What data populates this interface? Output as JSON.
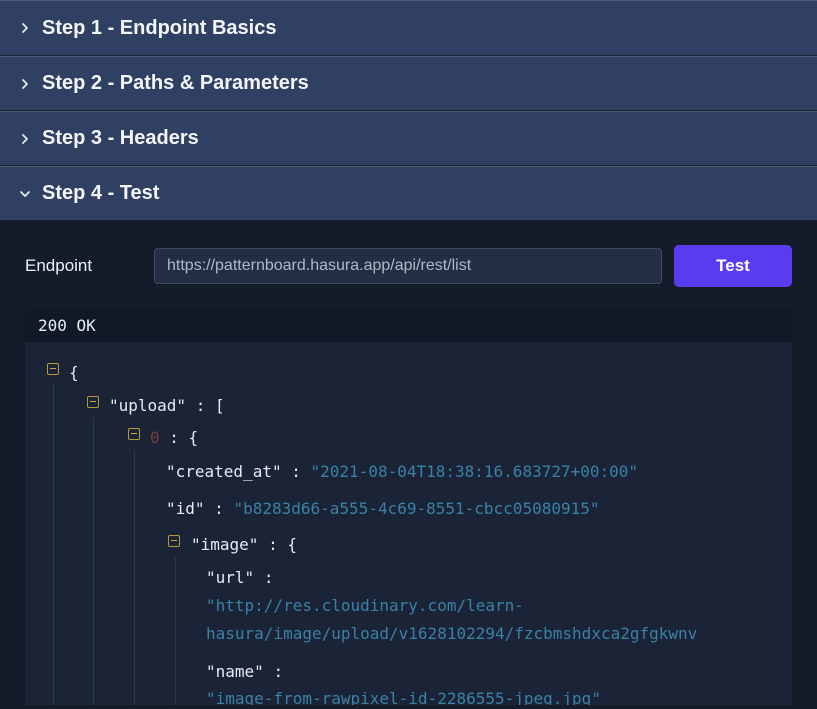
{
  "steps": [
    {
      "label": "Step 1 - Endpoint Basics",
      "expanded": false
    },
    {
      "label": "Step 2 - Paths & Parameters",
      "expanded": false
    },
    {
      "label": "Step 3 - Headers",
      "expanded": false
    },
    {
      "label": "Step 4 - Test",
      "expanded": true
    }
  ],
  "test": {
    "endpoint_label": "Endpoint",
    "endpoint_value": "https://patternboard.hasura.app/api/rest/list",
    "button_label": "Test"
  },
  "response": {
    "status": "200 OK",
    "json": {
      "root_open": "{",
      "upload_key": "\"upload\"",
      "upload_open": ": [",
      "index": "0",
      "index_open": ": {",
      "created_at_key": "\"created_at\"",
      "created_at_value": "\"2021-08-04T18:38:16.683727+00:00\"",
      "id_key": "\"id\"",
      "id_value": "\"b8283d66-a555-4c69-8551-cbcc05080915\"",
      "image_key": "\"image\"",
      "image_open": ": {",
      "url_key": "\"url\"",
      "url_value_line1": "\"http://res.cloudinary.com/learn-",
      "url_value_line2": "hasura/image/upload/v1628102294/fzcbmshdxca2gfgkwnv",
      "name_key": "\"name\"",
      "name_value": "\"image-from-rawpixel-id-2286555-jpeg.jpg\"",
      "colon": ":"
    }
  },
  "colors": {
    "header_bg": "#2f4062",
    "button_bg": "#5a3cf0",
    "string_value": "#3a81a6",
    "toggle_border": "#b39a37"
  },
  "icons": {
    "collapsed": "chevron-right-icon",
    "expanded": "chevron-down-icon",
    "json_collapse": "minus-square-icon"
  }
}
